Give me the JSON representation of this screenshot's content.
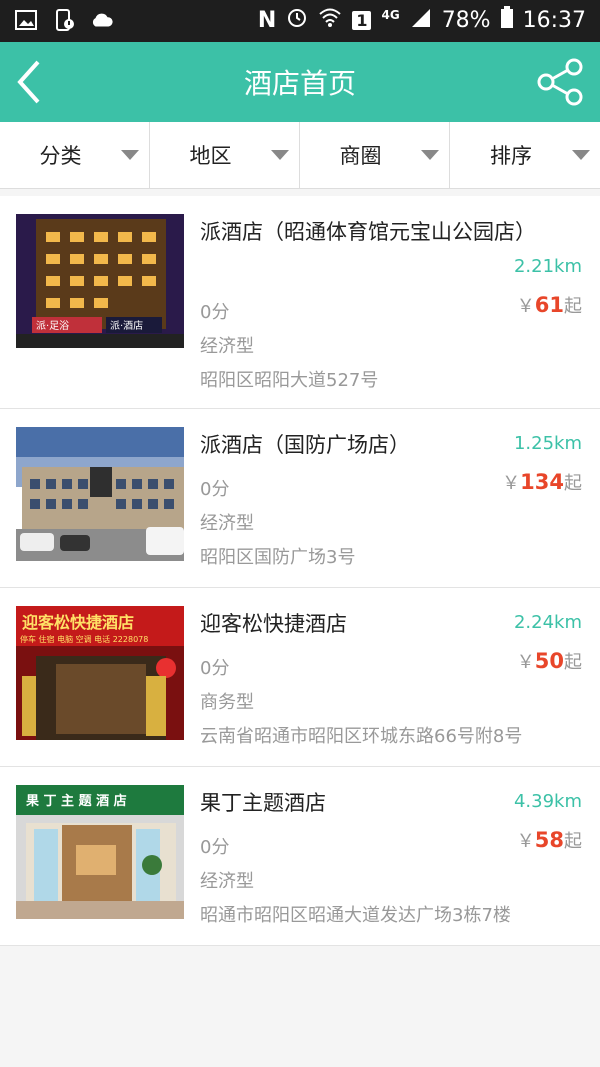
{
  "status_bar": {
    "icons_left": [
      "image-icon",
      "phone-alert-icon",
      "cloud-icon"
    ],
    "icons_right": [
      "nfc-icon",
      "alarm-icon",
      "wifi-icon",
      "sim-1-icon",
      "signal-4g-icon"
    ],
    "sim": "1",
    "network": "4G",
    "battery": "78%",
    "time": "16:37"
  },
  "header": {
    "title": "酒店首页",
    "back_icon": "chevron-left-icon",
    "share_icon": "share-icon"
  },
  "filters": [
    {
      "label": "分类"
    },
    {
      "label": "地区"
    },
    {
      "label": "商圈"
    },
    {
      "label": "排序"
    }
  ],
  "hotels": [
    {
      "name": "派酒店（昭通体育馆元宝山公园店）",
      "distance": "2.21km",
      "score": "0分",
      "currency": "￥",
      "price": "61",
      "price_suffix": "起",
      "type": "经济型",
      "address": "昭阳区昭阳大道527号",
      "thumb_sign_1": "派·足浴",
      "thumb_sign_2": "派·酒店"
    },
    {
      "name": "派酒店（国防广场店）",
      "distance": "1.25km",
      "score": "0分",
      "currency": "￥",
      "price": "134",
      "price_suffix": "起",
      "type": "经济型",
      "address": "昭阳区国防广场3号"
    },
    {
      "name": "迎客松快捷酒店",
      "distance": "2.24km",
      "score": "0分",
      "currency": "￥",
      "price": "50",
      "price_suffix": "起",
      "type": "商务型",
      "address": "云南省昭通市昭阳区环城东路66号附8号",
      "thumb_sign_1": "迎客松快捷酒店",
      "thumb_sign_2": "停车 住宿 电脑 空调   电话 2228078"
    },
    {
      "name": "果丁主题酒店",
      "distance": "4.39km",
      "score": "0分",
      "currency": "￥",
      "price": "58",
      "price_suffix": "起",
      "type": "经济型",
      "address": "昭通市昭阳区昭通大道发达广场3栋7楼",
      "thumb_sign_1": "果 丁 主 题 酒 店"
    }
  ],
  "colors": {
    "accent": "#3cc1a7",
    "price": "#e8462a",
    "muted": "#999999"
  }
}
